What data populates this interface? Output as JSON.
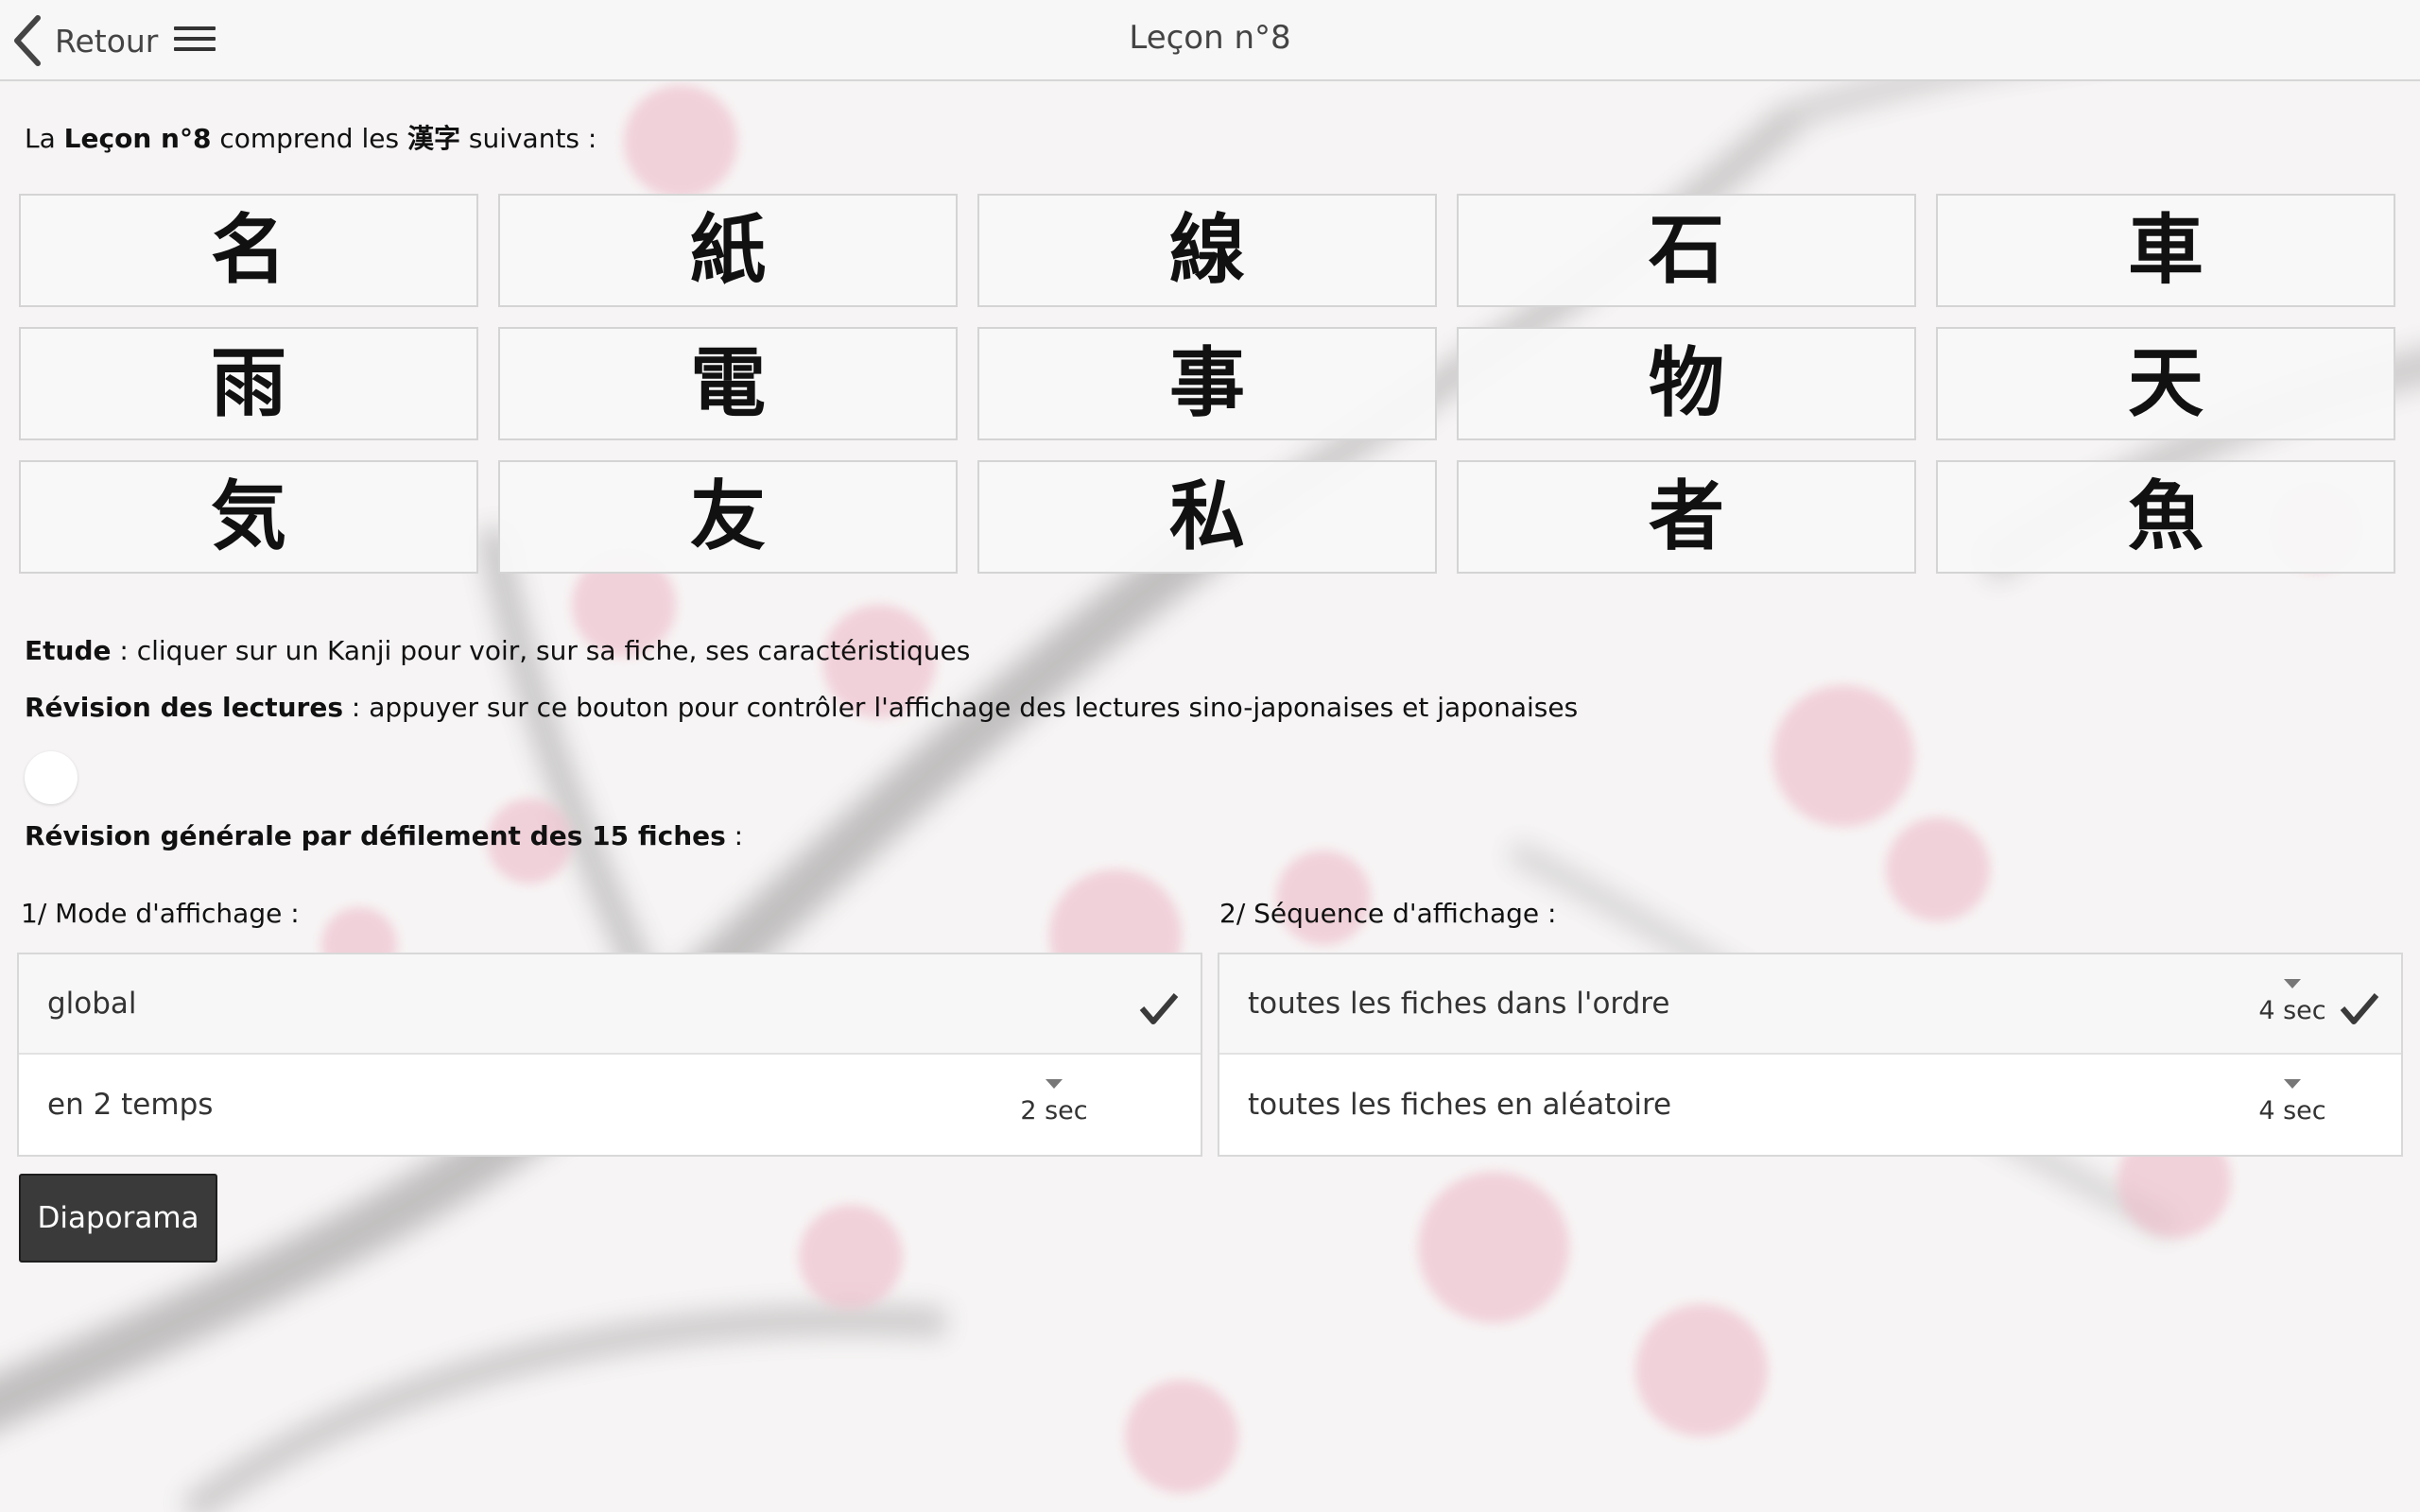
{
  "header": {
    "back_label": "Retour",
    "title": "Leçon n°8"
  },
  "intro": {
    "prefix": "La ",
    "lesson": "Leçon n°8",
    "middle": " comprend les ",
    "kanji_word": "漢字",
    "suffix": " suivants :"
  },
  "kanji": [
    "名",
    "紙",
    "線",
    "石",
    "車",
    "雨",
    "電",
    "事",
    "物",
    "天",
    "気",
    "友",
    "私",
    "者",
    "魚"
  ],
  "etude": {
    "label": "Etude",
    "text": " : cliquer sur un Kanji pour voir, sur sa fiche, ses caractéristiques"
  },
  "revision_lectures": {
    "label": "Révision des lectures",
    "text": " : appuyer sur ce bouton pour contrôler l'affichage des lectures sino-japonaises et japonaises"
  },
  "revision_generale": {
    "label": "Révision générale par défilement des 15 fiches",
    "text": " :"
  },
  "mode": {
    "label": "1/ Mode d'affichage :",
    "options": [
      {
        "label": "global",
        "selected": true
      },
      {
        "label": "en 2 temps",
        "duration": "2 sec"
      }
    ]
  },
  "sequence": {
    "label": "2/ Séquence d'affichage :",
    "options": [
      {
        "label": "toutes les fiches dans l'ordre",
        "duration": "4 sec",
        "selected": true
      },
      {
        "label": "toutes les fiches en aléatoire",
        "duration": "4 sec"
      }
    ]
  },
  "diaporama_label": "Diaporama",
  "colors": {
    "button_bg": "#3a3a3a",
    "blossom": "#e8a6b6",
    "header_bg": "#f7f7f7"
  }
}
